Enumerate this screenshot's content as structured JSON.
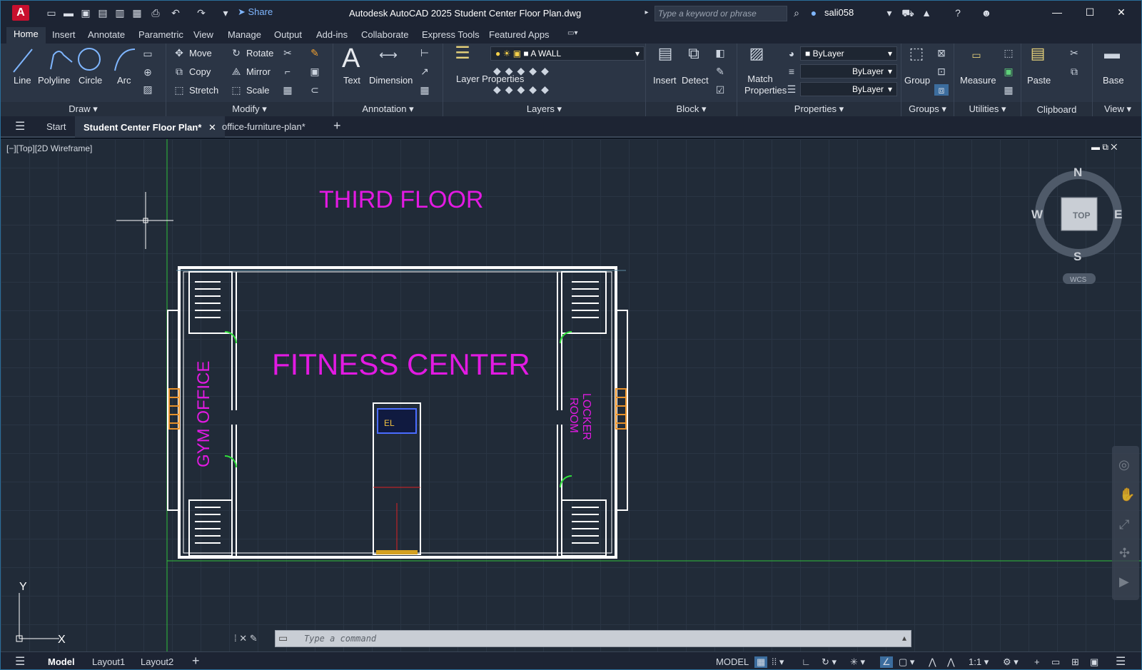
{
  "titlebar": {
    "logo": "A",
    "share": "Share",
    "title": "Autodesk AutoCAD 2025    Student Center Floor Plan.dwg",
    "search_placeholder": "Type a keyword or phrase",
    "user": "sali058"
  },
  "ribbon_tabs": [
    "Home",
    "Insert",
    "Annotate",
    "Parametric",
    "View",
    "Manage",
    "Output",
    "Add-ins",
    "Collaborate",
    "Express Tools",
    "Featured Apps"
  ],
  "draw": {
    "title": "Draw",
    "line": "Line",
    "polyline": "Polyline",
    "circle": "Circle",
    "arc": "Arc"
  },
  "modify": {
    "title": "Modify",
    "move": "Move",
    "rotate": "Rotate",
    "copy": "Copy",
    "mirror": "Mirror",
    "stretch": "Stretch",
    "scale": "Scale"
  },
  "annotation": {
    "title": "Annotation",
    "text": "Text",
    "dimension": "Dimension"
  },
  "layers": {
    "title": "Layers",
    "layer_properties": "Layer Properties",
    "current_layer": "A WALL"
  },
  "block": {
    "title": "Block",
    "insert": "Insert",
    "detect": "Detect"
  },
  "properties": {
    "title": "Properties",
    "match": "Match Properties",
    "color": "ByLayer",
    "linetype": "ByLayer",
    "lineweight": "ByLayer"
  },
  "groups": {
    "title": "Groups",
    "group": "Group"
  },
  "utilities": {
    "title": "Utilities",
    "measure": "Measure"
  },
  "clipboard": {
    "title": "Clipboard",
    "paste": "Paste"
  },
  "view": {
    "title": "View",
    "base": "Base"
  },
  "doctabs": {
    "start": "Start",
    "active": "Student Center Floor Plan*",
    "other": "office-furniture-plan*"
  },
  "viewport": {
    "label": "[−][Top][2D Wireframe]"
  },
  "drawing": {
    "floor": "THIRD FLOOR",
    "center": "FITNESS CENTER",
    "gym": "GYM OFFICE",
    "locker_1": "LOCKER",
    "locker_2": "ROOM",
    "ucs_y": "Y",
    "ucs_x": "X",
    "elevator": "EL"
  },
  "viewcube": {
    "n": "N",
    "s": "S",
    "e": "E",
    "w": "W",
    "top": "TOP",
    "wcs": "WCS"
  },
  "command": {
    "placeholder": "Type a command"
  },
  "status": {
    "model_tab": "Model",
    "layout1": "Layout1",
    "layout2": "Layout2",
    "model": "MODEL",
    "scale": "1:1"
  }
}
